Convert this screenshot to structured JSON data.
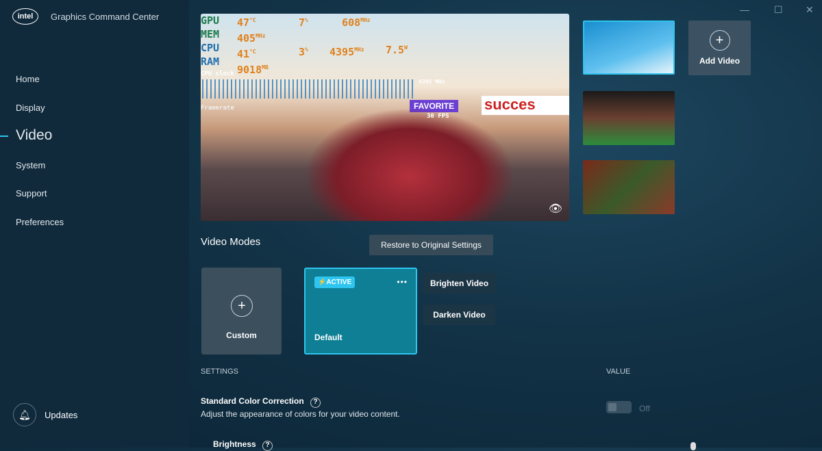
{
  "app": {
    "logo": "intel",
    "title": "Graphics Command Center"
  },
  "sidebar": {
    "items": [
      {
        "label": "Home"
      },
      {
        "label": "Display"
      },
      {
        "label": "Video"
      },
      {
        "label": "System"
      },
      {
        "label": "Support"
      },
      {
        "label": "Preferences"
      }
    ],
    "active": "Video",
    "updates": "Updates"
  },
  "osd": {
    "gpu": {
      "label": "GPU",
      "temp": "47",
      "temp_unit": "°C",
      "load": "7",
      "load_unit": "%",
      "clock": "608",
      "clock_unit": "MHz"
    },
    "mem": {
      "label": "MEM",
      "clock": "405",
      "clock_unit": "MHz"
    },
    "cpu": {
      "label": "CPU",
      "temp": "41",
      "temp_unit": "°C",
      "load": "3",
      "load_unit": "%",
      "clock": "4395",
      "clock_unit": "MHz",
      "power": "7.5",
      "power_unit": "W"
    },
    "ram": {
      "label": "RAM",
      "value": "9018",
      "unit": "MB"
    },
    "cpu_clock_label": "CPU clock",
    "cpu_clock_value": "4395 MHz",
    "framerate_label": "Framerate",
    "fps": "30 FPS"
  },
  "scene": {
    "banner": "succes",
    "favorite": "FAVORITE"
  },
  "add_video": "Add Video",
  "video_modes": {
    "title": "Video Modes",
    "restore": "Restore to Original Settings",
    "custom": "Custom",
    "default": "Default",
    "active_badge": "ACTIVE",
    "more": "•••",
    "brighten": "Brighten Video",
    "darken": "Darken Video"
  },
  "settings": {
    "header": "SETTINGS",
    "value_header": "VALUE",
    "color_correction": {
      "title": "Standard Color Correction",
      "desc": "Adjust the appearance of colors for your video content.",
      "value": "Off"
    },
    "brightness": "Brightness"
  },
  "colors": {
    "accent": "#2ec5f0",
    "active_card": "#0f7f95"
  }
}
